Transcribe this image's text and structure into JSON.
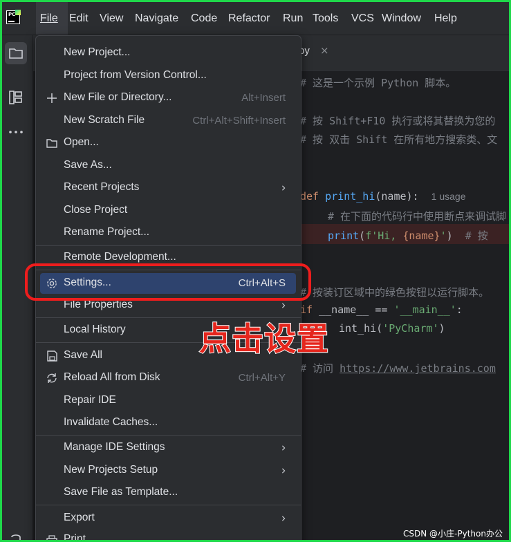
{
  "menubar": {
    "logo_text": "PC",
    "items": [
      {
        "label": "File",
        "u": "F"
      },
      {
        "label": "Edit",
        "u": "E"
      },
      {
        "label": "View",
        "u": "V"
      },
      {
        "label": "Navigate",
        "u": "N"
      },
      {
        "label": "Code",
        "u": "C"
      },
      {
        "label": "Refactor",
        "u": "R"
      },
      {
        "label": "Run",
        "u": "u"
      },
      {
        "label": "Tools",
        "u": "T"
      },
      {
        "label": "VCS",
        "u": "S"
      },
      {
        "label": "Window",
        "u": "W"
      },
      {
        "label": "Help",
        "u": "H"
      }
    ]
  },
  "editor": {
    "tab_label": "py",
    "tab_close": "×",
    "lines": {
      "l1": "# 这是一个示例 Python 脚本。",
      "l2": "# 按 Shift+F10 执行或将其替换为您的",
      "l3": "# 按 双击 Shift 在所有地方搜索类、文",
      "l4_kw": "def ",
      "l4_fn": "print_hi",
      "l4_rest": "(name):",
      "l4_hint": "1 usage",
      "l5": "# 在下面的代码行中使用断点来调试脚",
      "l6_fn": "print",
      "l6_a": "(",
      "l6_str": "f'Hi, ",
      "l6_var": "{name}",
      "l6_str2": "'",
      "l6_b": ")  ",
      "l6_com": "# 按",
      "l7": "# 按装订区域中的绿色按钮以运行脚本。",
      "l8_kw": "if ",
      "l8_a": "__name__ == ",
      "l8_str": "'__main__'",
      "l8_b": ":",
      "l9_a": "int_hi(",
      "l9_str": "'PyCharm'",
      "l9_b": ")",
      "l10_com": "# 访问 ",
      "l10_link": "https://www.jetbrains.com"
    }
  },
  "file_menu": {
    "items": {
      "new_project": {
        "label": "New Project..."
      },
      "project_vcs": {
        "label": "Project from Version Control..."
      },
      "new_file": {
        "label": "New File or Directory...",
        "shortcut": "Alt+Insert"
      },
      "scratch": {
        "label": "New Scratch File",
        "shortcut": "Ctrl+Alt+Shift+Insert"
      },
      "open": {
        "label": "Open..."
      },
      "save_as": {
        "label": "Save As..."
      },
      "recent": {
        "label": "Recent Projects"
      },
      "close": {
        "label": "Close Project"
      },
      "rename": {
        "label": "Rename Project..."
      },
      "remote": {
        "label": "Remote Development..."
      },
      "settings": {
        "label": "Settings...",
        "shortcut": "Ctrl+Alt+S"
      },
      "file_props": {
        "label": "File Properties"
      },
      "local_history": {
        "label": "Local History"
      },
      "save_all": {
        "label": "Save All"
      },
      "reload": {
        "label": "Reload All from Disk",
        "shortcut": "Ctrl+Alt+Y"
      },
      "repair": {
        "label": "Repair IDE"
      },
      "invalidate": {
        "label": "Invalidate Caches..."
      },
      "manage_ide": {
        "label": "Manage IDE Settings"
      },
      "new_projects_setup": {
        "label": "New Projects Setup"
      },
      "save_template": {
        "label": "Save File as Template..."
      },
      "export": {
        "label": "Export"
      },
      "print": {
        "label": "Print..."
      }
    }
  },
  "annotation": {
    "text": "点击设置",
    "color": "#e5261d"
  },
  "watermark": "CSDN @小庄-Python办公",
  "colors": {
    "highlight": "#2e436e",
    "menu_bg": "#2b2d30",
    "editor_bg": "#1e1f22",
    "frame": "#1fd84a"
  }
}
